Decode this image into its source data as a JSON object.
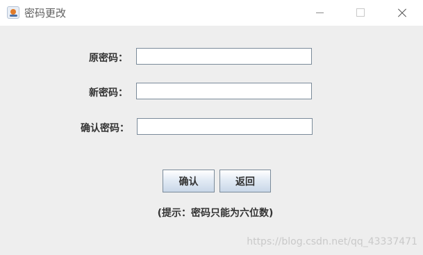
{
  "window": {
    "title": "密码更改",
    "icon": "java-cup-icon",
    "controls": [
      "minimize-icon",
      "maximize-icon",
      "close-icon"
    ]
  },
  "form": {
    "old_password_label": "原密码：",
    "old_password_value": "",
    "new_password_label": "新密码：",
    "new_password_value": "",
    "confirm_password_label": "确认密码：",
    "confirm_password_value": ""
  },
  "buttons": {
    "confirm_label": "确认",
    "back_label": "返回"
  },
  "hint": "(提示：密码只能为六位数)",
  "watermark": "https://blog.csdn.net/qq_43337471",
  "colors": {
    "background": "#eeeeee",
    "field_border": "#7a8a99",
    "button_gradient_bottom": "#c9d7e8"
  }
}
